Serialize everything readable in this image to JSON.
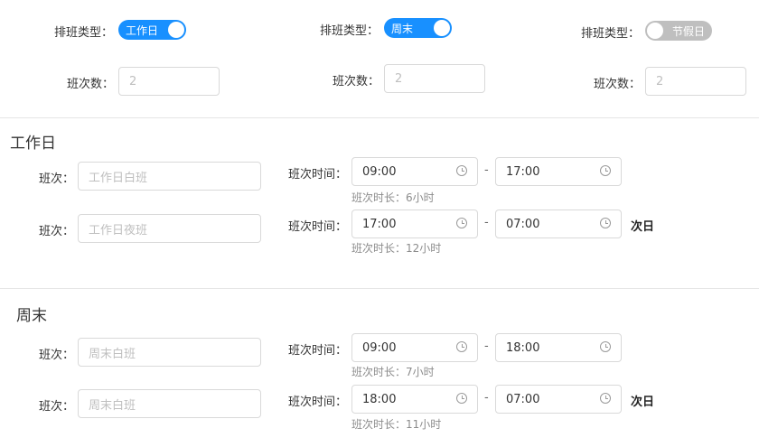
{
  "header": {
    "types": [
      {
        "label": "排班类型：",
        "switch_text": "工作日",
        "on": true,
        "count_label": "班次数：",
        "count_placeholder": "2"
      },
      {
        "label": "排班类型：",
        "switch_text": "周末",
        "on": true,
        "count_label": "班次数：",
        "count_placeholder": "2"
      },
      {
        "label": "排班类型：",
        "switch_text": "节假日",
        "on": false,
        "count_label": "班次数：",
        "count_placeholder": "2"
      }
    ]
  },
  "colors": {
    "accent": "#1890ff",
    "switch_off": "#bfbfbf"
  },
  "sections": [
    {
      "title": "工作日",
      "shifts": [
        {
          "label": "班次：",
          "name_placeholder": "工作日白班",
          "time_label": "班次时间：",
          "start": "09:00",
          "end": "17:00",
          "duration": "班次时长：6小时",
          "next_day": ""
        },
        {
          "label": "班次：",
          "name_placeholder": "工作日夜班",
          "time_label": "班次时间：",
          "start": "17:00",
          "end": "07:00",
          "duration": "班次时长：12小时",
          "next_day": "次日"
        }
      ]
    },
    {
      "title": "周末",
      "shifts": [
        {
          "label": "班次：",
          "name_placeholder": "周末白班",
          "time_label": "班次时间：",
          "start": "09:00",
          "end": "18:00",
          "duration": "班次时长：7小时",
          "next_day": ""
        },
        {
          "label": "班次：",
          "name_placeholder": "周末白班",
          "time_label": "班次时间：",
          "start": "18:00",
          "end": "07:00",
          "duration": "班次时长：11小时",
          "next_day": "次日"
        }
      ]
    }
  ],
  "icons": {
    "time_picker": "clock-icon"
  },
  "range_separator": "-"
}
